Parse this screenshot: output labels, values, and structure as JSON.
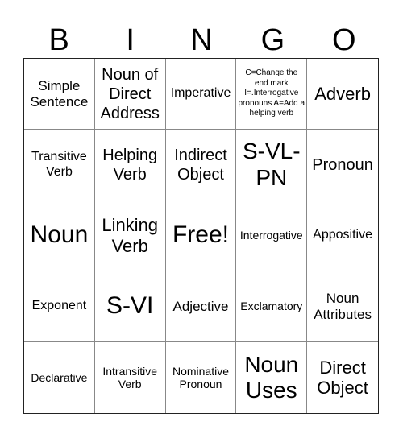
{
  "header": {
    "letters": [
      "B",
      "I",
      "N",
      "G",
      "O"
    ]
  },
  "cells": [
    "Simple Sentence",
    "Noun of Direct Address",
    "Imperative",
    "C=Change the end mark I=.Interrogative pronouns A=Add a helping verb",
    "Adverb",
    "Transitive Verb",
    "Helping Verb",
    "Indirect Object",
    "S-VL-PN",
    "Pronoun",
    "Noun",
    "Linking Verb",
    "Free!",
    "Interrogative",
    "Appositive",
    "Exponent",
    "S-VI",
    "Adjective",
    "Exclamatory",
    "Noun Attributes",
    "Declarative",
    "Intransitive Verb",
    "Nominative Pronoun",
    "Noun Uses",
    "Direct Object"
  ]
}
